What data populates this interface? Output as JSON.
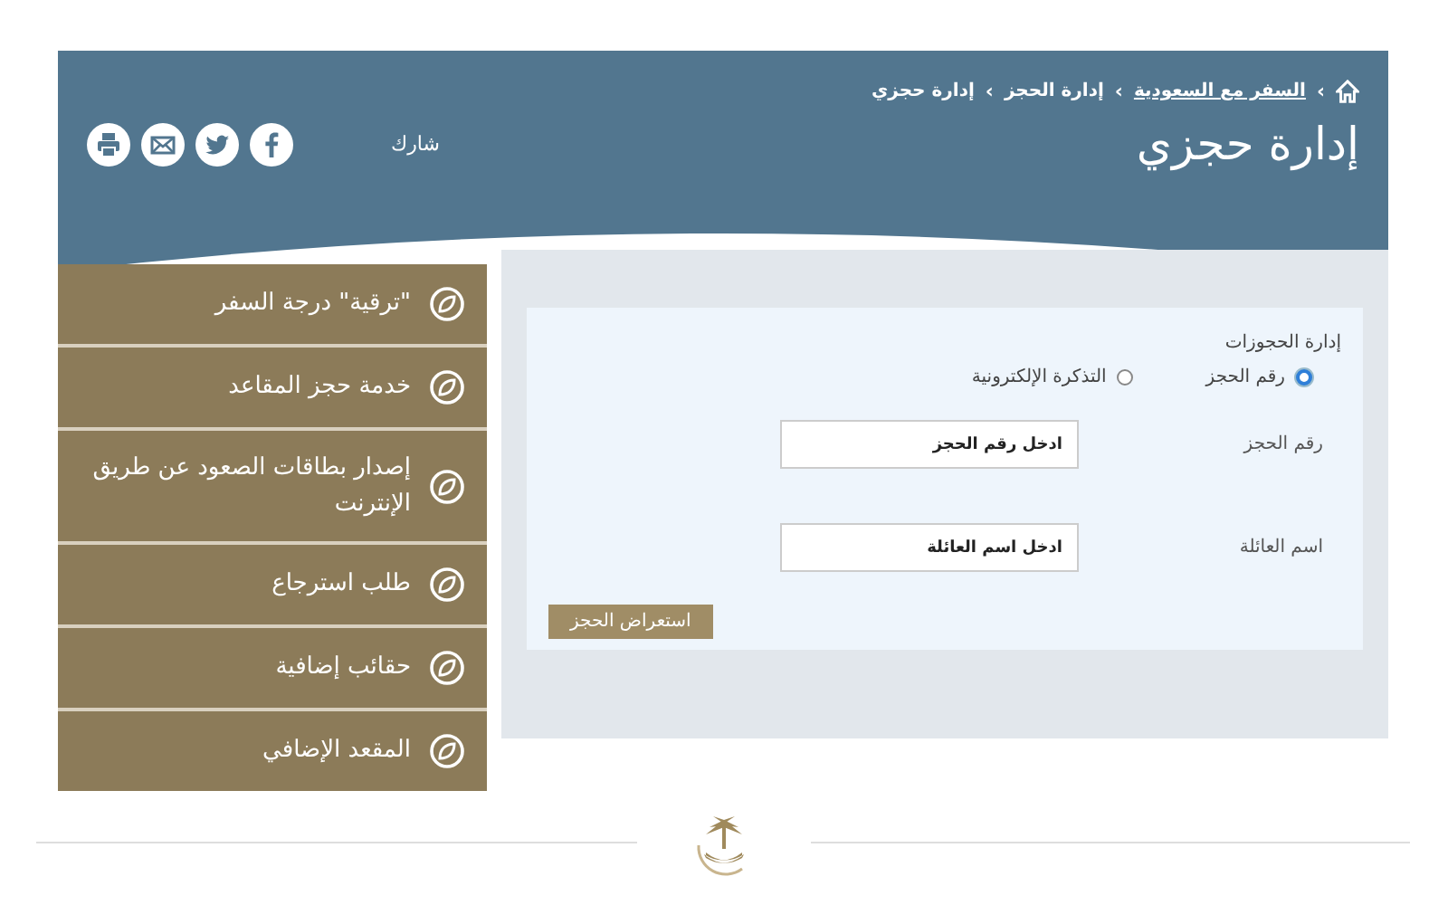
{
  "breadcrumb": [
    {
      "sep": "›",
      "label": "السفر مع السعودية",
      "link": true
    },
    {
      "sep": "›",
      "label": "إدارة الحجز",
      "link": false
    },
    {
      "sep": "›",
      "label": "إدارة حجزي",
      "link": false
    }
  ],
  "title": "إدارة حجزي",
  "share": {
    "label": "شارك",
    "icons": [
      {
        "kind": "facebook"
      },
      {
        "kind": "twitter"
      },
      {
        "kind": "mail"
      },
      {
        "kind": "print"
      }
    ]
  },
  "sidebar": {
    "items": [
      {
        "label": "\"ترقية\" درجة السفر"
      },
      {
        "label": "خدمة حجز المقاعد"
      },
      {
        "label": "إصدار بطاقات الصعود عن طريق الإنترنت"
      },
      {
        "label": "طلب استرجاع"
      },
      {
        "label": "حقائب إضافية"
      },
      {
        "label": "المقعد الإضافي"
      }
    ]
  },
  "form": {
    "heading": "إدارة الحجوزات",
    "options": [
      {
        "label": "رقم الحجز",
        "selected": true
      },
      {
        "label": "التذكرة الإلكترونية",
        "selected": false
      }
    ],
    "fields": [
      {
        "label": "رقم الحجز",
        "placeholder": "ادخل رقم الحجز"
      },
      {
        "label": "اسم العائلة",
        "placeholder": "ادخل اسم العائلة"
      }
    ],
    "submit": "استعراض الحجز"
  }
}
